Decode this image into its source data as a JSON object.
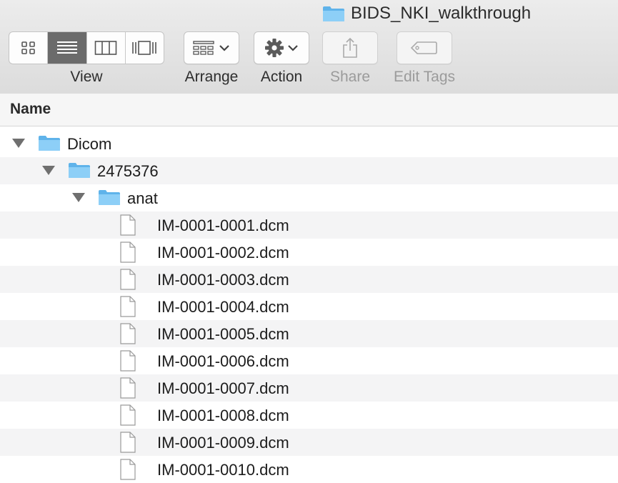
{
  "window": {
    "title": "BIDS_NKI_walkthrough",
    "title_icon": "folder-icon"
  },
  "toolbar": {
    "view_label": "View",
    "view_modes": [
      {
        "icon": "icon-view-icon",
        "active": false
      },
      {
        "icon": "list-view-icon",
        "active": true
      },
      {
        "icon": "column-view-icon",
        "active": false
      },
      {
        "icon": "cover-flow-icon",
        "active": false
      }
    ],
    "arrange_label": "Arrange",
    "arrange_icon": "arrange-grid-icon",
    "action_label": "Action",
    "action_icon": "gear-icon",
    "share_label": "Share",
    "share_icon": "share-icon",
    "share_enabled": false,
    "edit_tags_label": "Edit Tags",
    "edit_tags_icon": "tag-icon",
    "edit_tags_enabled": false
  },
  "columns": {
    "name": "Name"
  },
  "colors": {
    "folder_blue": "#7cc7f5",
    "folder_tab": "#5fb3ea",
    "disclosure": "#6f6f6f",
    "active_segment": "#6b6b6b",
    "stripe": "#f4f4f5"
  },
  "files": [
    {
      "name": "Dicom",
      "kind": "folder",
      "level": 0,
      "expanded": true
    },
    {
      "name": "2475376",
      "kind": "folder",
      "level": 1,
      "expanded": true
    },
    {
      "name": "anat",
      "kind": "folder",
      "level": 2,
      "expanded": true
    },
    {
      "name": "IM-0001-0001.dcm",
      "kind": "file",
      "level": 3
    },
    {
      "name": "IM-0001-0002.dcm",
      "kind": "file",
      "level": 3
    },
    {
      "name": "IM-0001-0003.dcm",
      "kind": "file",
      "level": 3
    },
    {
      "name": "IM-0001-0004.dcm",
      "kind": "file",
      "level": 3
    },
    {
      "name": "IM-0001-0005.dcm",
      "kind": "file",
      "level": 3
    },
    {
      "name": "IM-0001-0006.dcm",
      "kind": "file",
      "level": 3
    },
    {
      "name": "IM-0001-0007.dcm",
      "kind": "file",
      "level": 3
    },
    {
      "name": "IM-0001-0008.dcm",
      "kind": "file",
      "level": 3
    },
    {
      "name": "IM-0001-0009.dcm",
      "kind": "file",
      "level": 3
    },
    {
      "name": "IM-0001-0010.dcm",
      "kind": "file",
      "level": 3
    }
  ]
}
